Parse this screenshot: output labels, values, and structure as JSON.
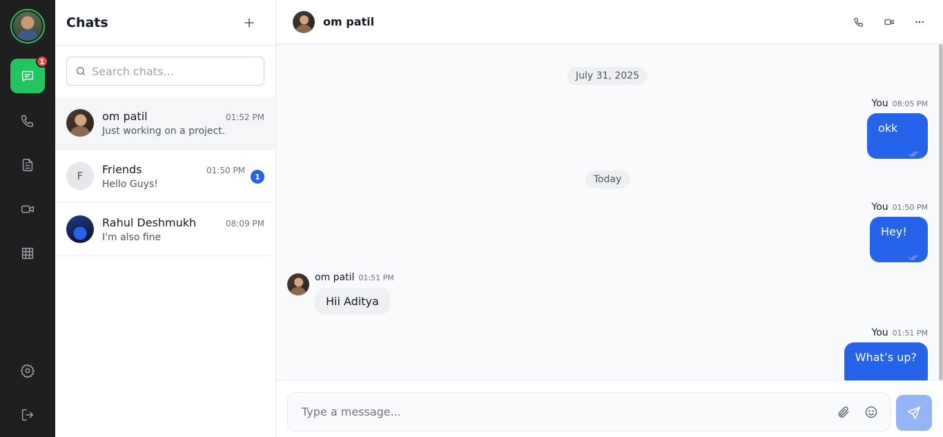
{
  "rail": {
    "unread_badge": "1",
    "items": [
      "chat-bubble-icon",
      "phone-icon",
      "document-icon",
      "video-icon",
      "grid-icon"
    ],
    "bottom": [
      "gear-icon",
      "logout-icon"
    ],
    "active_color": "#22c55e"
  },
  "list": {
    "title": "Chats",
    "search_placeholder": "Search chats...",
    "chats": [
      {
        "name": "om patil",
        "time": "01:52 PM",
        "preview": "Just working on a project.",
        "avatar": "",
        "unread": ""
      },
      {
        "name": "Friends",
        "time": "01:50 PM",
        "preview": "Hello Guys!",
        "avatar": "F",
        "unread": "1"
      },
      {
        "name": "Rahul Deshmukh",
        "time": "08:09 PM",
        "preview": "I'm also fine",
        "avatar": "",
        "unread": ""
      }
    ]
  },
  "conversation": {
    "contact_name": "om patil",
    "date_1": "July 31, 2025",
    "date_2": "Today",
    "messages": [
      {
        "who": "You",
        "time": "08:05 PM",
        "text": "okk"
      },
      {
        "who": "You",
        "time": "01:50 PM",
        "text": "Hey!"
      },
      {
        "who": "om patil",
        "time": "01:51 PM",
        "text": "Hii Aditya"
      },
      {
        "who": "You",
        "time": "01:51 PM",
        "text": "What’s up?"
      }
    ],
    "composer_placeholder": "Type a message...",
    "accent_color": "#2563eb"
  }
}
